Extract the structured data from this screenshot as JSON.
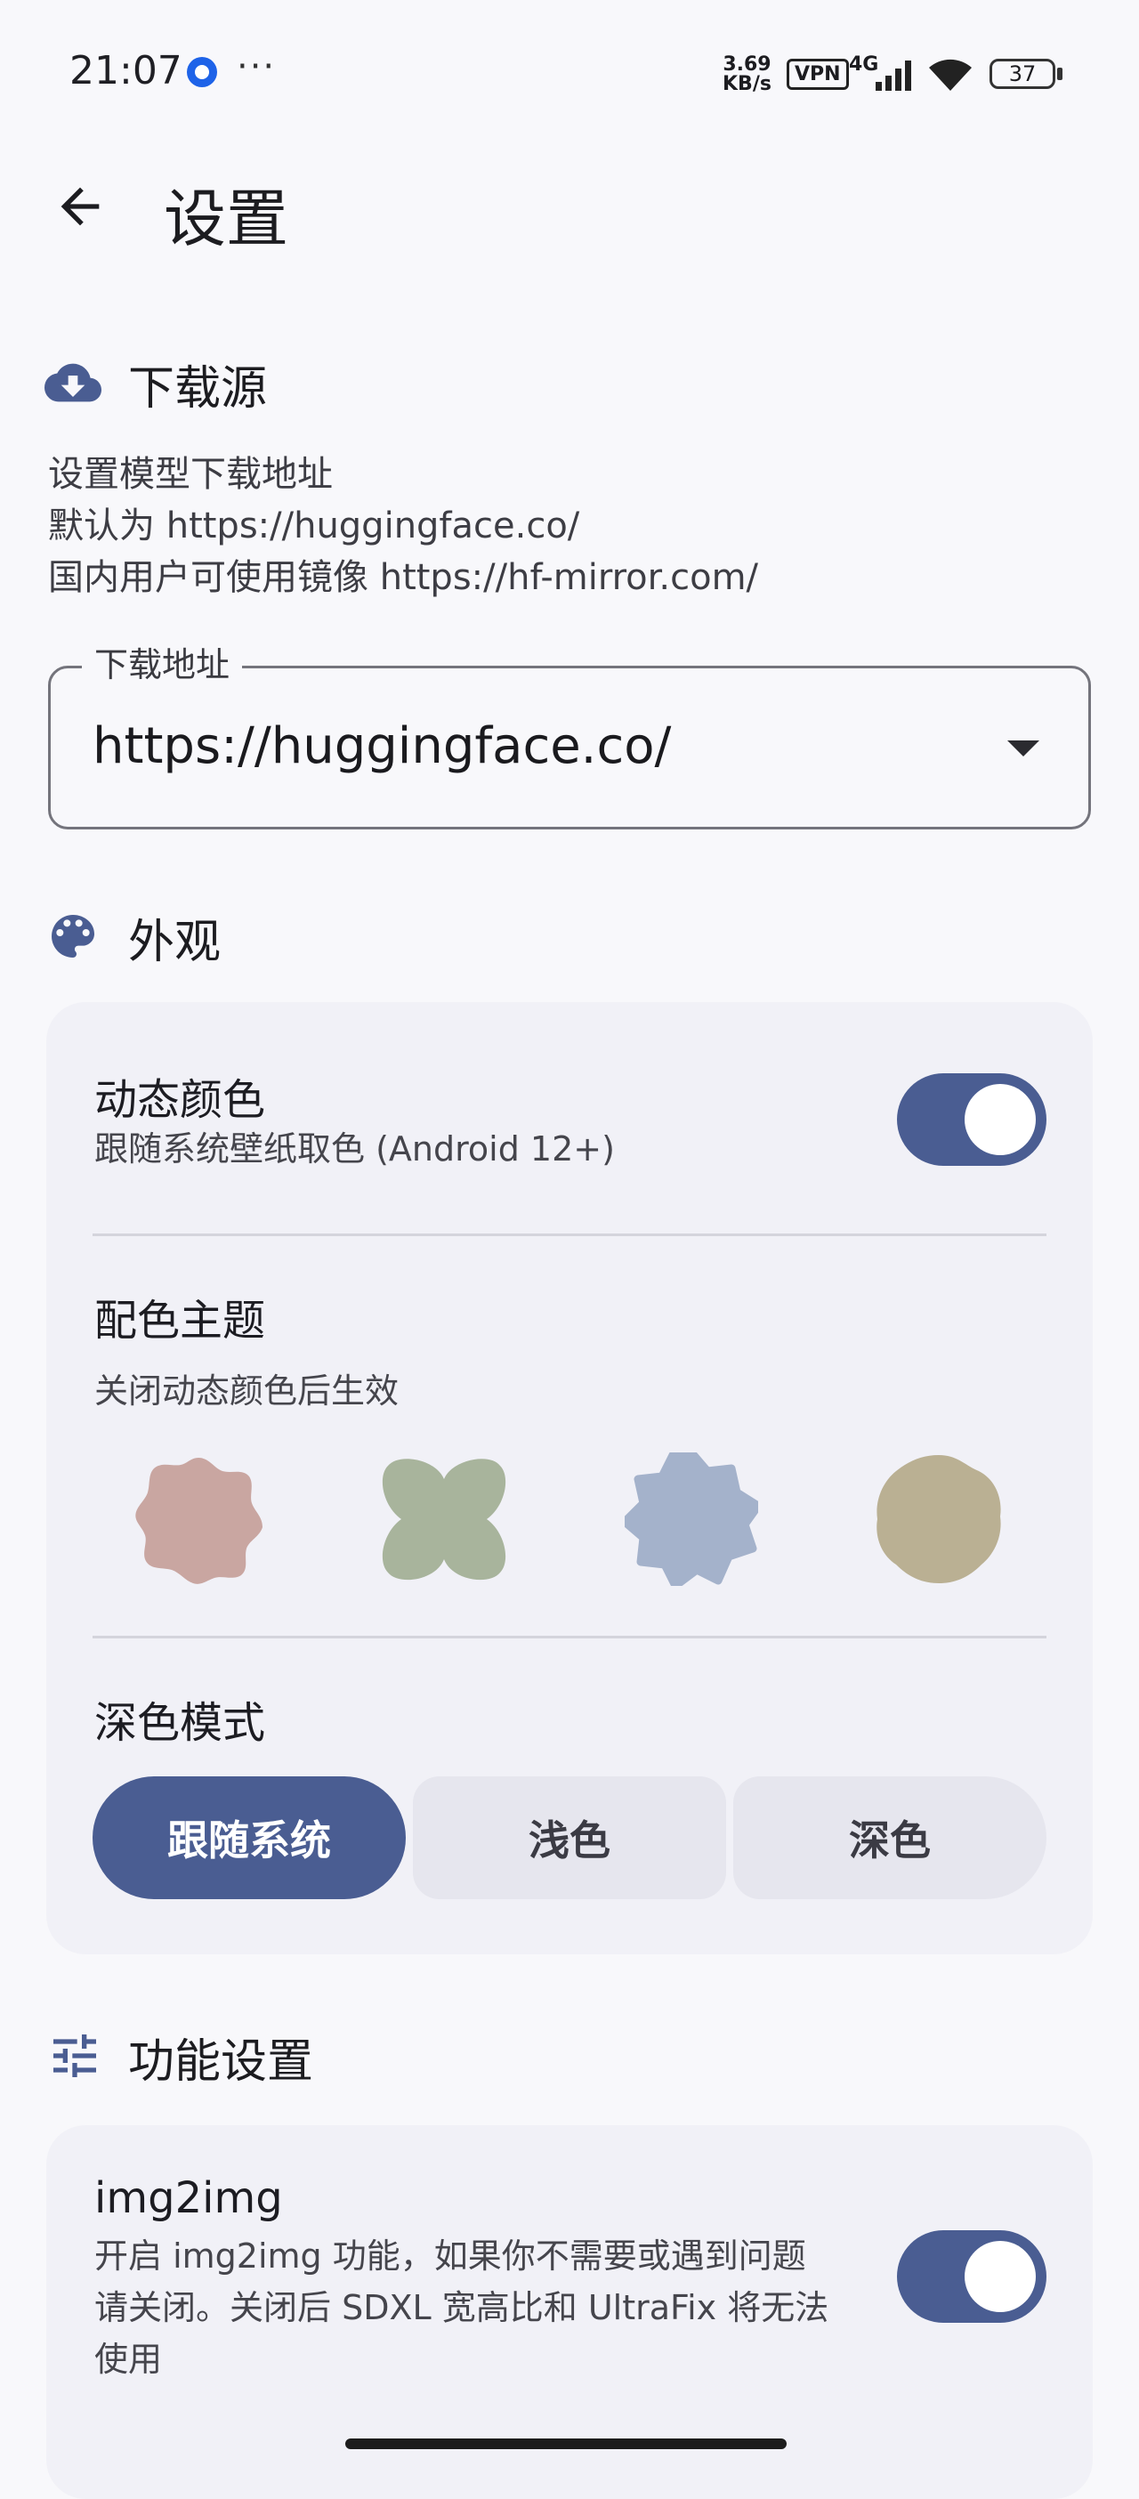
{
  "status_bar": {
    "time": "21:07",
    "dots": "···",
    "speed_value": "3.69",
    "speed_unit": "KB/s",
    "vpn": "VPN",
    "network": "4G",
    "battery": "37"
  },
  "header": {
    "title": "设置",
    "back_icon": "arrow-left-icon"
  },
  "download": {
    "section_title": "下载源",
    "icon": "cloud-download-icon",
    "desc_line1": "设置模型下载地址",
    "desc_line2": "默认为 https://huggingface.co/",
    "desc_line3": "国内用户可使用镜像 https://hf-mirror.com/",
    "field_label": "下载地址",
    "field_value": "https://huggingface.co/"
  },
  "appearance": {
    "section_title": "外观",
    "icon": "palette-icon",
    "dynamic_color": {
      "title": "动态颜色",
      "subtitle": "跟随系统壁纸取色 (Android 12+)",
      "enabled": true
    },
    "theme": {
      "title": "配色主题",
      "subtitle": "关闭动态颜色后生效",
      "swatches": [
        "#c9a6a1",
        "#a8b49c",
        "#a4b2cb",
        "#bab093"
      ]
    },
    "dark_mode": {
      "title": "深色模式",
      "options": [
        "跟随系统",
        "浅色",
        "深色"
      ],
      "selected": "跟随系统"
    }
  },
  "features": {
    "section_title": "功能设置",
    "icon": "tune-sliders-icon",
    "img2img": {
      "title": "img2img",
      "desc_line1": "开启 img2img 功能，如果你不需要或遇到问题",
      "desc_line2": "请关闭。关闭后 SDXL 宽高比和 UltraFix 将无法",
      "desc_line3": "使用",
      "enabled": true
    }
  },
  "colors": {
    "accent": "#4a5d92",
    "background": "#f8f8fb",
    "card": "#f1f1f7"
  }
}
